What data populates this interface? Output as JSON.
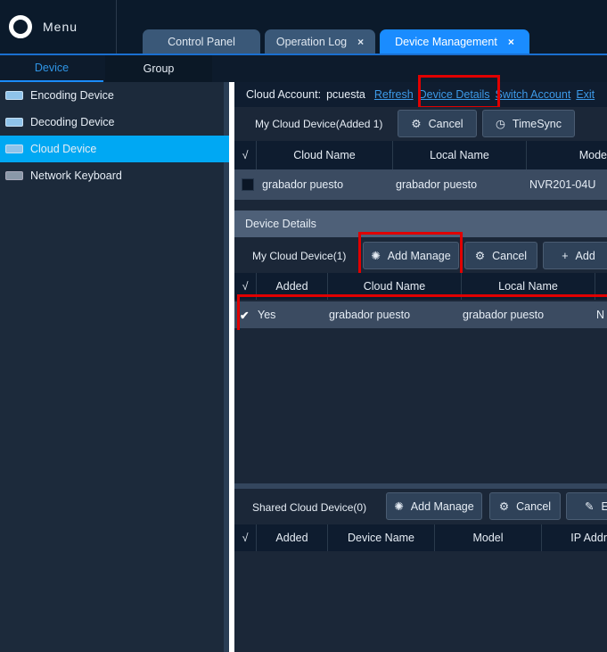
{
  "header": {
    "menu_label": "Menu",
    "tabs": [
      {
        "label": "Control Panel"
      },
      {
        "label": "Operation Log",
        "close": "×"
      },
      {
        "label": "Device Management",
        "close": "×",
        "active": true
      }
    ]
  },
  "subtabs": [
    {
      "label": "Device",
      "active": true
    },
    {
      "label": "Group"
    }
  ],
  "sidebar": {
    "items": [
      {
        "label": "Encoding Device"
      },
      {
        "label": "Decoding Device"
      },
      {
        "label": "Cloud Device",
        "selected": true
      },
      {
        "label": "Network Keyboard"
      }
    ]
  },
  "account": {
    "label": "Cloud Account:",
    "user": "pcuesta",
    "refresh": "Refresh",
    "details": "Device Details",
    "switch": "Switch Account",
    "exit": "Exit"
  },
  "my_cloud": {
    "title": "My Cloud Device(Added 1)",
    "cancel": "Cancel",
    "timesync": "TimeSync",
    "columns": [
      "√",
      "Cloud Name",
      "Local Name",
      "Mode"
    ],
    "rows": [
      {
        "checked": false,
        "cloud_name": "grabador puesto",
        "local_name": "grabador puesto",
        "model": "NVR201-04U"
      }
    ]
  },
  "details": {
    "title": "Device Details",
    "section": "My Cloud Device(1)",
    "add_manage": "Add Manage",
    "cancel": "Cancel",
    "add": "Add",
    "columns": [
      "√",
      "Added",
      "Cloud Name",
      "Local Name"
    ],
    "rows": [
      {
        "checked": true,
        "added": "Yes",
        "cloud_name": "grabador puesto",
        "local_name": "grabador puesto",
        "model": "N"
      }
    ]
  },
  "shared": {
    "section": "Shared Cloud Device(0)",
    "add_manage": "Add Manage",
    "cancel": "Cancel",
    "edit": "E",
    "columns": [
      "√",
      "Added",
      "Device Name",
      "Model",
      "IP Addr"
    ]
  },
  "colors": {
    "accent": "#1a8cff",
    "selected": "#00a8f3",
    "highlight": "#e00000"
  }
}
